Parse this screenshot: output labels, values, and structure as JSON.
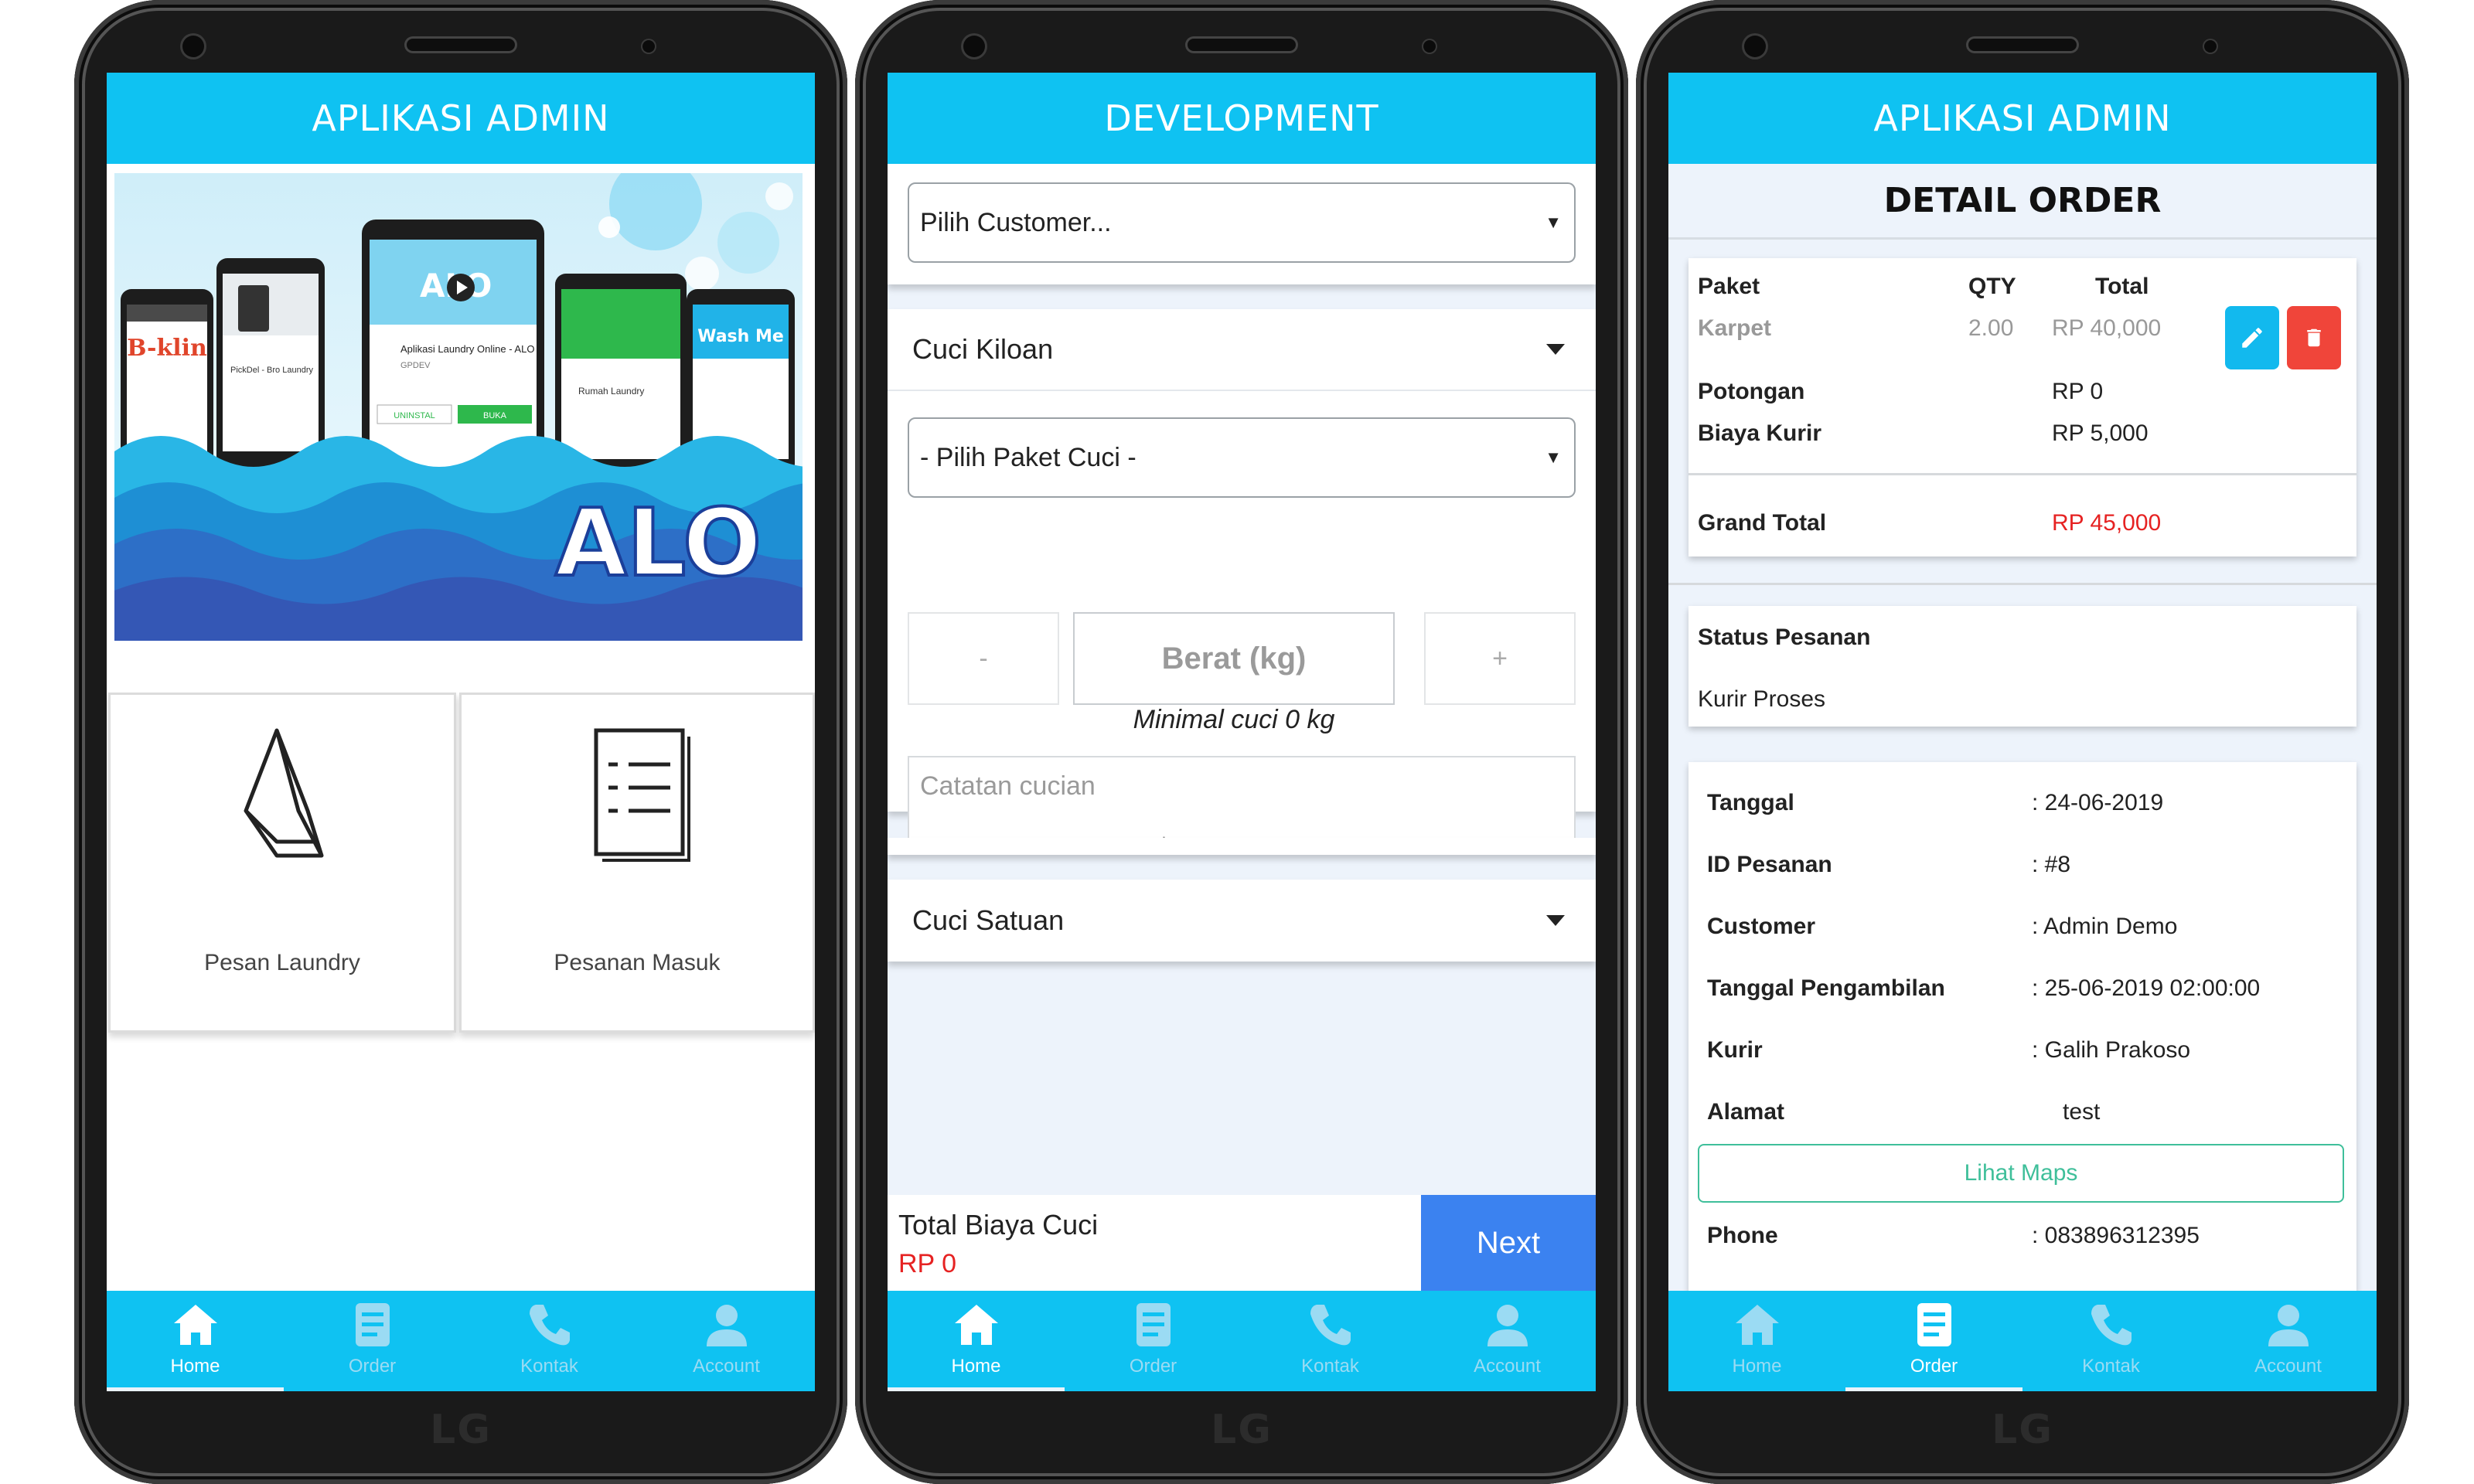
{
  "screen_home": {
    "appbar_title": "APLIKASI ADMIN",
    "banner": {
      "apps": [
        "B-klin",
        "PickDel - Bro Laundry",
        "ALO",
        "Rumah Laundry",
        "Wash Me"
      ],
      "center_app_title": "Aplikasi Laundry Online - ALO",
      "center_developer": "GPDEV",
      "uninstall_label": "UNINSTAL",
      "open_label": "BUKA",
      "logo_text": "ALO"
    },
    "tiles": [
      {
        "label": "Pesan Laundry",
        "icon": "droplet-icon"
      },
      {
        "label": "Pesanan Masuk",
        "icon": "document-icon"
      }
    ]
  },
  "screen_order_form": {
    "appbar_title": "DEVELOPMENT",
    "customer_select": "Pilih Customer...",
    "section_kiloan": "Cuci Kiloan",
    "paket_select": "- Pilih Paket Cuci -",
    "minus_label": "-",
    "weight_placeholder": "Berat (kg)",
    "plus_label": "+",
    "min_note": "Minimal cuci 0 kg",
    "note_placeholder": "Catatan cucian",
    "section_satuan": "Cuci Satuan",
    "total_label": "Total Biaya Cuci",
    "total_value": "RP 0",
    "next_label": "Next"
  },
  "screen_detail": {
    "appbar_title": "APLIKASI ADMIN",
    "page_title": "DETAIL ORDER",
    "table_headers": {
      "paket": "Paket",
      "qty": "QTY",
      "total": "Total"
    },
    "item": {
      "name": "Karpet",
      "qty": "2.00",
      "total": "RP 40,000"
    },
    "potongan_label": "Potongan",
    "potongan_value": "RP 0",
    "kurir_label": "Biaya Kurir",
    "kurir_value": "RP 5,000",
    "grand_total_label": "Grand Total",
    "grand_total_value": "RP 45,000",
    "status_label": "Status Pesanan",
    "status_value": "Kurir Proses",
    "details": [
      {
        "label": "Tanggal",
        "value": ": 24-06-2019"
      },
      {
        "label": "ID Pesanan",
        "value": ": #8"
      },
      {
        "label": "Customer",
        "value": ": Admin Demo"
      },
      {
        "label": "Tanggal Pengambilan",
        "value": ": 25-06-2019 02:00:00"
      },
      {
        "label": "Kurir",
        "value": ": Galih Prakoso"
      },
      {
        "label": "Alamat",
        "value": "test"
      }
    ],
    "maps_button": "Lihat Maps",
    "phone_label": "Phone",
    "phone_value": ": 083896312395"
  },
  "bottom_nav": [
    {
      "label": "Home",
      "icon": "home-icon"
    },
    {
      "label": "Order",
      "icon": "order-icon"
    },
    {
      "label": "Kontak",
      "icon": "phone-icon"
    },
    {
      "label": "Account",
      "icon": "account-icon"
    }
  ],
  "device_brand": "LG",
  "colors": {
    "primary": "#0fc2f2",
    "next_button": "#3b82f0",
    "edit_button": "#12b9ee",
    "delete_button": "#f0453a",
    "grand_total": "#e62222",
    "maps_button": "#3fbf9a",
    "background": "#edf3fb"
  }
}
